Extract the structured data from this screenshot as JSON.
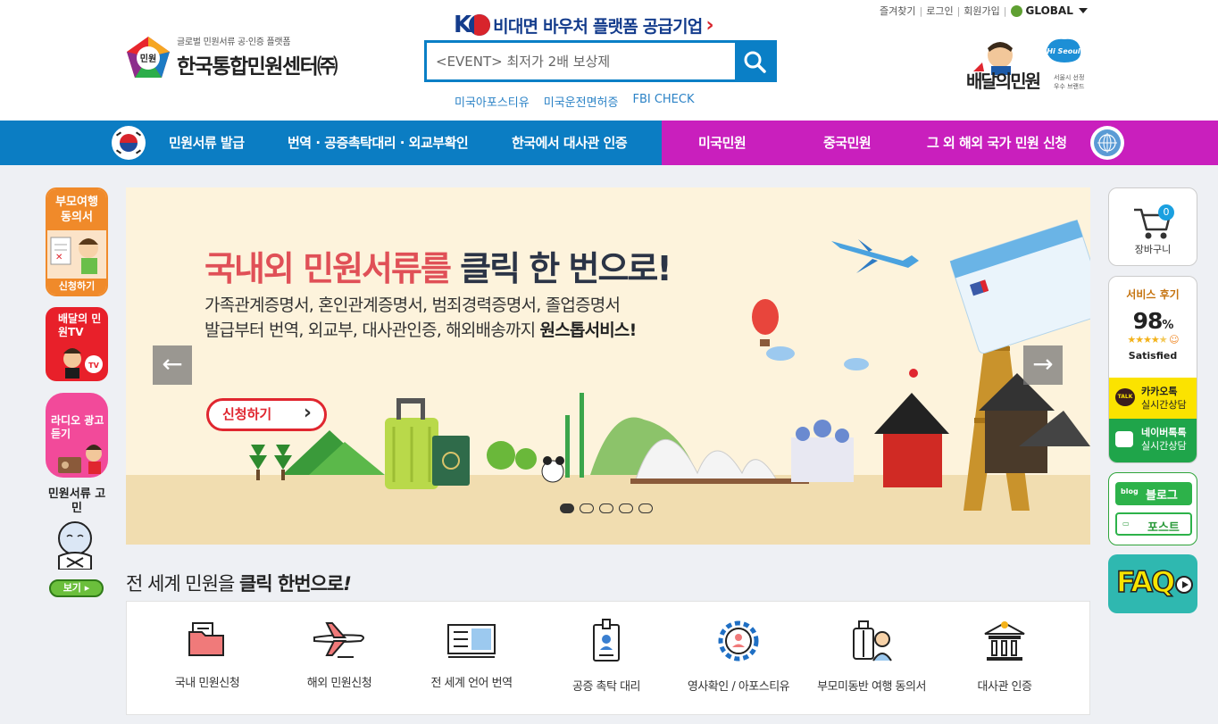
{
  "header": {
    "util_links": [
      "즐겨찾기",
      "로그인",
      "회원가입"
    ],
    "global_label": "GLOBAL",
    "logo_badge": "민원",
    "logo_sub": "글로벌 민원서류 공·인증 플랫폼",
    "logo_main": "한국통합민원센터㈜",
    "voucher_k": "K",
    "voucher_text": "비대면 바우처 플랫폼 공급기업",
    "search_value": "<EVENT> 최저가 2배 보상제",
    "quick_links": [
      "미국아포스티유",
      "미국운전면허증",
      "FBI CHECK"
    ],
    "brand_name": "배달의민원",
    "brand_badge": "Hi Seoul",
    "brand_sub_1": "서울시 선정",
    "brand_sub_2": "우수 브랜드"
  },
  "nav": {
    "items": [
      "민원서류 발급",
      "번역 · 공증촉탁대리 · 외교부확인",
      "한국에서 대사관 인증",
      "미국민원",
      "중국민원",
      "그 외 해외 국가 민원 신청"
    ],
    "colors": {
      "blue": "#0b7dc3",
      "pink": "#c91fbd"
    }
  },
  "left_rail": {
    "card1_title": "부모여행 동의서",
    "card1_button": "신청하기",
    "card2_title": "배달의 민원TV",
    "card3_title": "라디오 광고듣기",
    "gomin_title": "민원서류 고민",
    "gomin_button": "보기"
  },
  "banner": {
    "title_a": "국내외 민원서류를",
    "title_b": "클릭 한 번으로!",
    "desc_line1": "가족관계증명서, 혼인관계증명서, 범죄경력증명서, 졸업증명서",
    "desc_line2_a": "발급부터 번역, 외교부, 대사관인증, 해외배송까지",
    "desc_line2_b": "원스톱서비스!",
    "button": "신청하기",
    "slide_count": 5,
    "active_slide": 1
  },
  "right_rail": {
    "cart_count": "0",
    "cart_label": "장바구니",
    "review_title": "서비스 후기",
    "review_pct": "98",
    "review_pct_unit": "%",
    "review_rating": 4.5,
    "review_label": "Satisfied",
    "kakao_line1": "카카오톡",
    "kakao_line2": "실시간상담",
    "naver_line1": "네이버톡톡",
    "naver_line2": "실시간상담",
    "blog_label": "블로그",
    "post_label": "포스트",
    "faq_label": "FAQ"
  },
  "services": {
    "title_a": "전 세계 민원을",
    "title_b": "클릭 한번으로",
    "title_c": "!",
    "items": [
      {
        "label": "국내 민원신청",
        "icon": "folder-icon"
      },
      {
        "label": "해외 민원신청",
        "icon": "airplane-icon"
      },
      {
        "label": "전 세계 언어 번역",
        "icon": "translation-icon"
      },
      {
        "label": "공증 촉탁 대리",
        "icon": "id-badge-icon"
      },
      {
        "label": "영사확인 / 아포스티유",
        "icon": "gear-person-icon"
      },
      {
        "label": "부모미동반 여행 동의서",
        "icon": "luggage-icon"
      },
      {
        "label": "대사관 인증",
        "icon": "embassy-icon"
      }
    ]
  }
}
